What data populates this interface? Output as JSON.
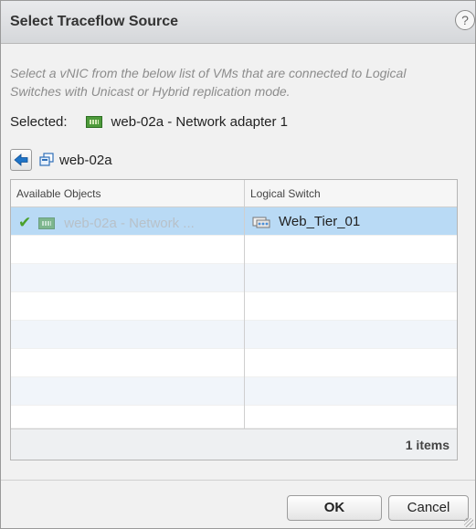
{
  "dialog": {
    "title": "Select Traceflow Source",
    "help_glyph": "?",
    "instructions": "Select a vNIC from the below list of VMs that are connected to Logical Switches with Unicast or Hybrid replication mode.",
    "selected_label": "Selected:",
    "selected_value": "web-02a - Network adapter 1",
    "selected_icon": "network-adapter-icon"
  },
  "nav": {
    "back_icon": "back-arrow-icon",
    "vm_icon": "vm-icon",
    "vm_name": "web-02a"
  },
  "table": {
    "columns": [
      "Available Objects",
      "Logical Switch"
    ],
    "rows": [
      {
        "object": "web-02a - Network ...",
        "logical_switch": "Web_Tier_01",
        "status_icon": "check-icon",
        "object_icon": "network-adapter-icon",
        "switch_icon": "logical-switch-icon"
      }
    ],
    "item_count": "1 items"
  },
  "buttons": {
    "ok": "OK",
    "cancel": "Cancel"
  },
  "colors": {
    "selection": "#b9daf5",
    "check": "#4aa02c",
    "accent_blue": "#1f74c7"
  }
}
